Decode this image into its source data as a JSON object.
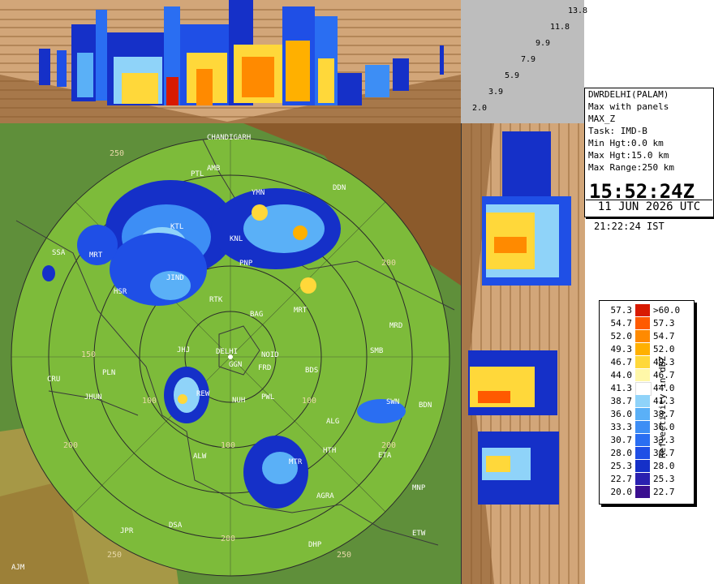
{
  "radar": {
    "station": "DWRDELHI(PALAM)",
    "product": "Max with panels",
    "product_code": "MAX_Z",
    "task": "Task: IMD-B",
    "min_hgt": "Min Hgt:0.0 km",
    "max_hgt": "Max Hgt:15.0 km",
    "max_range": "Max Range:250 km",
    "time_utc": "15:52:24Z",
    "date_utc": "11 JUN 2026 UTC",
    "time_ist": "21:22:24 IST"
  },
  "height_axis": [
    "13.8",
    "11.8",
    "9.9",
    "7.9",
    "5.9",
    "3.9",
    "2.0"
  ],
  "range_rings": [
    "250",
    "200",
    "150",
    "100"
  ],
  "stations": [
    "CHANDIGARH",
    "DDN",
    "PTL",
    "MRT",
    "AMB",
    "YMN",
    "KNL",
    "JIND",
    "KTL",
    "PNP",
    "HSR",
    "RTK",
    "BAG",
    "MRD",
    "MRT",
    "JHJ",
    "DELHI",
    "NOID",
    "FRD",
    "GGN",
    "BDS",
    "SMB",
    "CRU",
    "PLN",
    "JHUN",
    "REW",
    "NUH",
    "PWL",
    "ALG",
    "SWN",
    "BDN",
    "ALW",
    "HTH",
    "ETA",
    "MTR",
    "AGRA",
    "MNP",
    "JPR",
    "DSA",
    "ETW",
    "DHP",
    "AJM",
    "SSA"
  ],
  "legend": {
    "title": "Reflectivity in dBZ",
    "colors": {
      "r1": "#3a0f8f",
      "r2": "#1530c8",
      "r3": "#1f4fe6",
      "r4": "#2a6ef2",
      "r5": "#3d8ef5",
      "r6": "#5ab0f7",
      "r7": "#8fd3f9",
      "r8": "#ffffff",
      "r9": "#fff7a8",
      "r10": "#ffd83a",
      "r11": "#ffb000",
      "r12": "#ff8a00",
      "r13": "#ff5a00",
      "r14": "#d81a00"
    },
    "rows": [
      {
        "low": "57.3",
        "high": ">60.0"
      },
      {
        "low": "54.7",
        "high": "57.3"
      },
      {
        "low": "52.0",
        "high": "54.7"
      },
      {
        "low": "49.3",
        "high": "52.0"
      },
      {
        "low": "46.7",
        "high": "49.3"
      },
      {
        "low": "44.0",
        "high": "46.7"
      },
      {
        "low": "41.3",
        "high": "44.0"
      },
      {
        "low": "38.7",
        "high": "41.3"
      },
      {
        "low": "36.0",
        "high": "38.7"
      },
      {
        "low": "33.3",
        "high": "36.0"
      },
      {
        "low": "30.7",
        "high": "33.3"
      },
      {
        "low": "28.0",
        "high": "30.7"
      },
      {
        "low": "25.3",
        "high": "28.0"
      },
      {
        "low": "22.7",
        "high": "25.3"
      },
      {
        "low": "20.0",
        "high": "22.7"
      }
    ]
  }
}
